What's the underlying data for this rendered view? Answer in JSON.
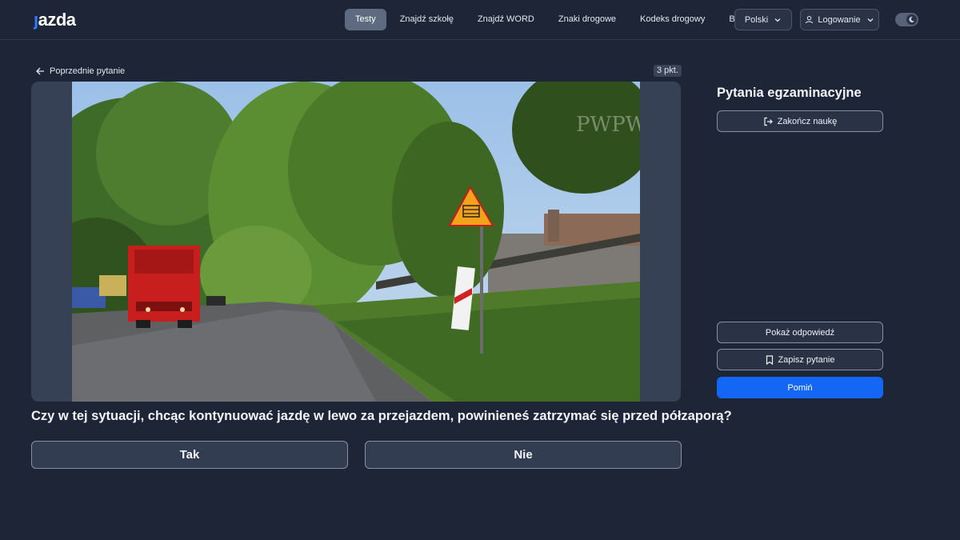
{
  "header": {
    "logo_text": "jazda",
    "nav": [
      "Testy",
      "Znajdź szkołę",
      "Znajdź WORD",
      "Znaki drogowe",
      "Kodeks drogowy",
      "Blog"
    ],
    "active_nav": "Testy",
    "language_label": "Polski",
    "login_label": "Logowanie",
    "theme_toggle_icon": "moon-icon"
  },
  "question": {
    "back_label": "Poprzednie pytanie",
    "points_label": "3 pkt.",
    "text": "Czy w tej sytuacji, chcąc kontynuować jazdę w lewo za przejazdem, powinieneś zatrzymać się przed półzaporą?",
    "answers": [
      "Tak",
      "Nie"
    ],
    "media": {
      "watermark_right": "PWPW",
      "description_icons": [
        "railway-crossing-warning-sign",
        "red-truck",
        "road",
        "trees"
      ]
    }
  },
  "sidebar": {
    "title": "Pytania egzaminacyjne",
    "end_label": "Zakończ naukę",
    "show_answer_label": "Pokaż odpowiedź",
    "save_label": "Zapisz pytanie",
    "skip_label": "Pomiń"
  },
  "colors": {
    "background": "#1e2536",
    "primary": "#1467f5",
    "accent_logo": "#2f7bff"
  }
}
